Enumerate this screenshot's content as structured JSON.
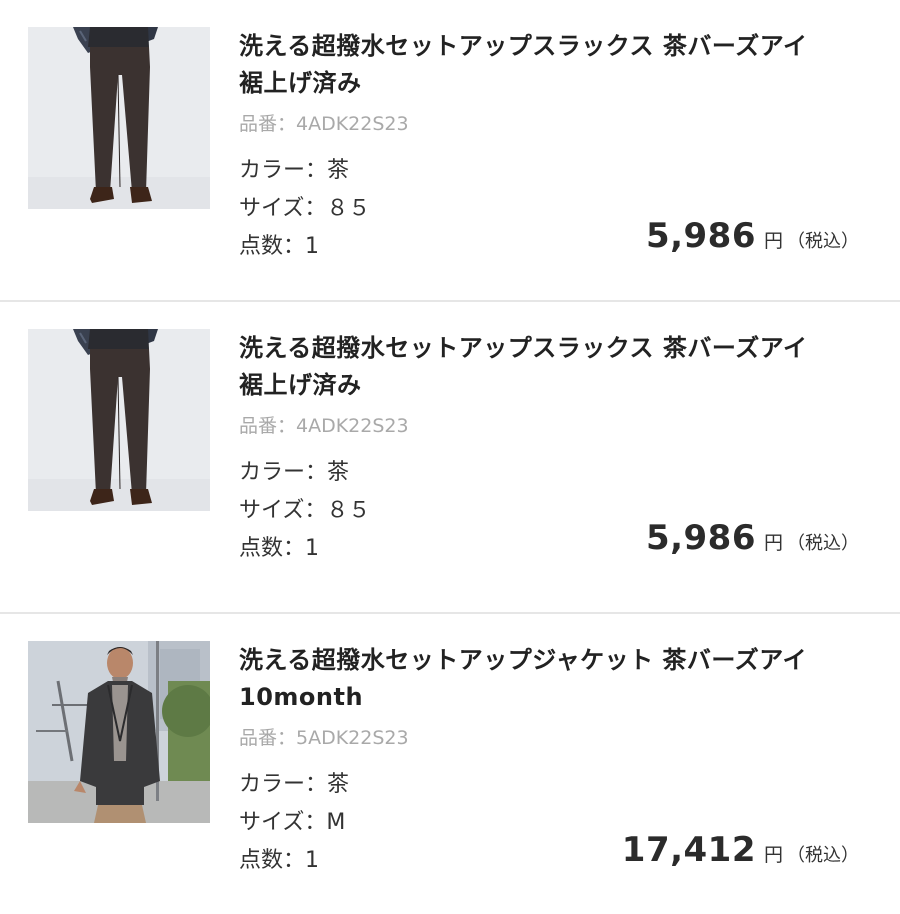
{
  "items": [
    {
      "title_line1": "洗える超撥水セットアップスラックス 茶バーズアイ",
      "title_line2": "裾上げ済み",
      "code": "品番：4ADK22S23",
      "color": "カラー：茶",
      "size": "サイズ：８５",
      "qty": "点数：1",
      "price": "5,986",
      "yen": "円",
      "tax": "（税込）",
      "image": "trousers-photo"
    },
    {
      "title_line1": "洗える超撥水セットアップスラックス 茶バーズアイ",
      "title_line2": "裾上げ済み",
      "code": "品番：4ADK22S23",
      "color": "カラー：茶",
      "size": "サイズ：８５",
      "qty": "点数：1",
      "price": "5,986",
      "yen": "円",
      "tax": "（税込）",
      "image": "trousers-photo"
    },
    {
      "title_line1": "洗える超撥水セットアップジャケット 茶バーズアイ",
      "title_line2": "10month",
      "code": "品番：5ADK22S23",
      "color": "カラー：茶",
      "size": "サイズ：M",
      "qty": "点数：1",
      "price": "17,412",
      "yen": "円",
      "tax": "（税込）",
      "image": "jacket-photo"
    }
  ],
  "colors": {
    "title": "#222222",
    "code": "#a9a9a9",
    "text": "#333333",
    "separator": "#e6e6e6"
  }
}
